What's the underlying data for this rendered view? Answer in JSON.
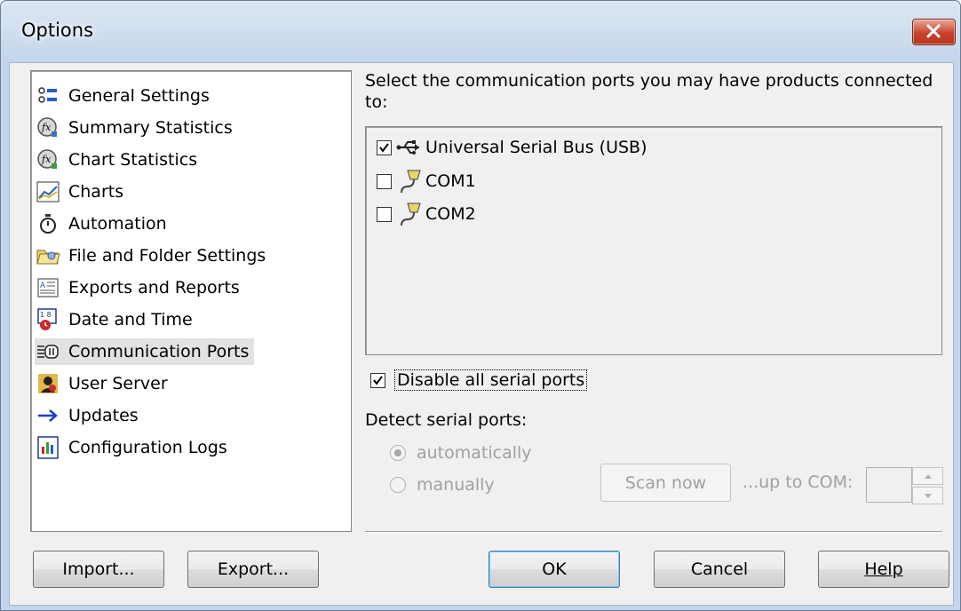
{
  "window": {
    "title": "Options"
  },
  "sidebar": {
    "items": [
      {
        "label": "General Settings",
        "icon": "settings-list-icon"
      },
      {
        "label": "Summary Statistics",
        "icon": "fx-statistics-icon"
      },
      {
        "label": "Chart Statistics",
        "icon": "fx-chart-statistics-icon"
      },
      {
        "label": "Charts",
        "icon": "line-chart-icon"
      },
      {
        "label": "Automation",
        "icon": "stopwatch-icon"
      },
      {
        "label": "File and Folder Settings",
        "icon": "folder-icon"
      },
      {
        "label": "Exports and Reports",
        "icon": "report-icon"
      },
      {
        "label": "Date and Time",
        "icon": "calendar-clock-icon"
      },
      {
        "label": "Communication Ports",
        "icon": "ports-icon",
        "selected": true
      },
      {
        "label": "User Server",
        "icon": "user-server-icon"
      },
      {
        "label": "Updates",
        "icon": "arrow-right-icon"
      },
      {
        "label": "Configuration Logs",
        "icon": "log-icon"
      }
    ]
  },
  "ports_panel": {
    "prompt": "Select the communication ports you may have products connected to:",
    "ports": [
      {
        "label": "Universal Serial Bus (USB)",
        "checked": true,
        "icon": "usb-icon"
      },
      {
        "label": "COM1",
        "checked": false,
        "icon": "serial-cable-icon"
      },
      {
        "label": "COM2",
        "checked": false,
        "icon": "serial-cable-icon"
      }
    ],
    "disable_serial": {
      "label": "Disable all serial ports",
      "checked": true
    },
    "detect_label": "Detect serial ports:",
    "detect_options": [
      {
        "label": "automatically",
        "selected": true
      },
      {
        "label": "manually",
        "selected": false
      }
    ],
    "scan_button": "Scan now",
    "upto_label": "...up to COM:",
    "upto_value": ""
  },
  "buttons": {
    "import": "Import...",
    "export": "Export...",
    "ok": "OK",
    "cancel": "Cancel",
    "help": "Help"
  },
  "colors": {
    "title_gradient_top": "#dce7f4",
    "close_button": "#c7432b",
    "selected_item_bg": "#e2e2e2",
    "disabled_text": "#a0a0a0"
  }
}
